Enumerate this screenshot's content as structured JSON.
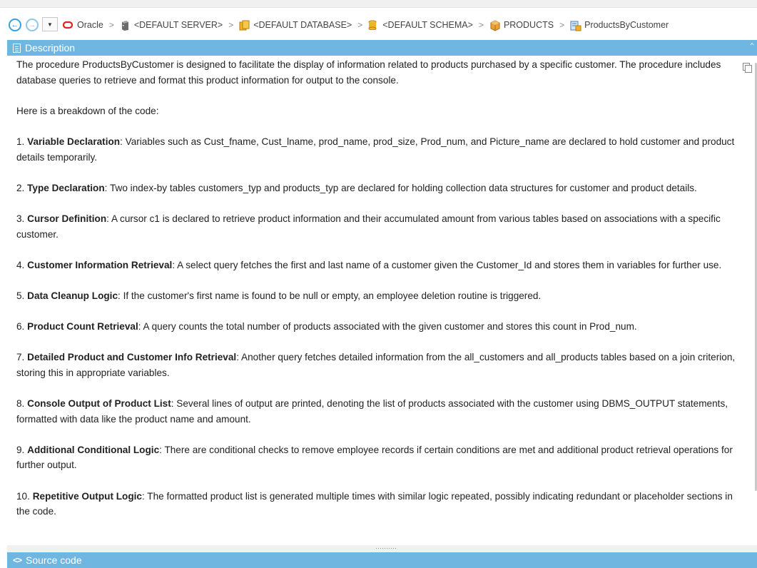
{
  "breadcrumb": {
    "items": [
      {
        "label": "Oracle",
        "icon": "oracle-icon"
      },
      {
        "label": "<DEFAULT SERVER>",
        "icon": "server-icon"
      },
      {
        "label": "<DEFAULT DATABASE>",
        "icon": "database-icon"
      },
      {
        "label": "<DEFAULT SCHEMA>",
        "icon": "schema-icon"
      },
      {
        "label": "PRODUCTS",
        "icon": "package-icon"
      },
      {
        "label": "ProductsByCustomer",
        "icon": "procedure-icon"
      }
    ],
    "separator": ">"
  },
  "description_panel": {
    "title": "Description",
    "intro": "The procedure ProductsByCustomer is designed to facilitate the display of information related to products purchased by a specific customer. The procedure includes database queries to retrieve and format this product information for output to the console.",
    "breakdown_heading": "Here is a breakdown of the code:",
    "items": [
      {
        "num": "1.",
        "title": "Variable Declaration",
        "text": ": Variables such as Cust_fname, Cust_lname, prod_name, prod_size, Prod_num, and Picture_name are declared to hold customer and product details temporarily."
      },
      {
        "num": "2.",
        "title": "Type Declaration",
        "text": ": Two index-by tables customers_typ and products_typ are declared for holding collection data structures for customer and product details."
      },
      {
        "num": "3.",
        "title": "Cursor Definition",
        "text": ": A cursor c1 is declared to retrieve product information and their accumulated amount from various tables based on associations with a specific customer."
      },
      {
        "num": "4.",
        "title": "Customer Information Retrieval",
        "text": ": A select query fetches the first and last name of a customer given the Customer_Id and stores them in variables for further use."
      },
      {
        "num": "5.",
        "title": "Data Cleanup Logic",
        "text": ": If the customer's first name is found to be null or empty, an employee deletion routine is triggered."
      },
      {
        "num": "6.",
        "title": "Product Count Retrieval",
        "text": ": A query counts the total number of products associated with the given customer and stores this count in Prod_num."
      },
      {
        "num": "7.",
        "title": "Detailed Product and Customer Info Retrieval",
        "text": ": Another query fetches detailed information from the all_customers and all_products tables based on a join criterion, storing this in appropriate variables."
      },
      {
        "num": "8.",
        "title": "Console Output of Product List",
        "text": ": Several lines of output are printed, denoting the list of products associated with the customer using DBMS_OUTPUT statements, formatted with data like the product name and amount."
      },
      {
        "num": "9.",
        "title": "Additional Conditional Logic",
        "text": ": There are conditional checks to remove employee records if certain conditions are met and additional product retrieval operations for further output."
      },
      {
        "num": "10.",
        "title": "Repetitive Output Logic",
        "text": ": The formatted product list is generated multiple times with similar logic repeated, possibly indicating redundant or placeholder sections in the code."
      }
    ]
  },
  "source_panel": {
    "title": "Source code"
  },
  "colors": {
    "panel_header": "#6fb7e0",
    "nav_accent": "#3aa0dc",
    "oracle_red": "#d9261c"
  }
}
